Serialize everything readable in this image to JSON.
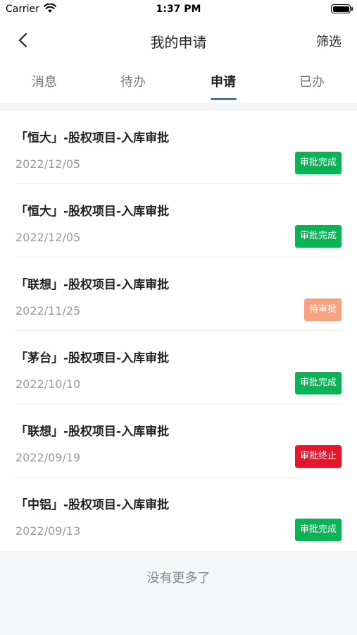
{
  "status_bar": {
    "carrier": "Carrier",
    "time": "1:37 PM",
    "wifi_icon": "wifi-icon",
    "battery_icon": "battery-icon"
  },
  "nav": {
    "back_icon": "chevron-left-icon",
    "title": "我的申请",
    "filter_label": "筛选"
  },
  "tabs": [
    {
      "label": "消息",
      "active": false
    },
    {
      "label": "待办",
      "active": false
    },
    {
      "label": "申请",
      "active": true
    },
    {
      "label": "已办",
      "active": false
    }
  ],
  "tab_underline_color": "#1677ff",
  "items": [
    {
      "title": "「恒大」-股权项目-入库审批",
      "date": "2022/12/05",
      "status": "审批完成",
      "status_color": "#0ab454"
    },
    {
      "title": "「恒大」-股权项目-入库审批",
      "date": "2022/12/05",
      "status": "审批完成",
      "status_color": "#0ab454"
    },
    {
      "title": "「联想」-股权项目-入库审批",
      "date": "2022/11/25",
      "status": "待审批",
      "status_color": "#f8a27f"
    },
    {
      "title": "「茅台」-股权项目-入库审批",
      "date": "2022/10/10",
      "status": "审批完成",
      "status_color": "#0ab454"
    },
    {
      "title": "「联想」-股权项目-入库审批",
      "date": "2022/09/19",
      "status": "审批终止",
      "status_color": "#e6152a"
    },
    {
      "title": "「中铝」-股权项目-入库审批",
      "date": "2022/09/13",
      "status": "审批完成",
      "status_color": "#0ab454"
    }
  ],
  "footer": {
    "text": "没有更多了"
  }
}
